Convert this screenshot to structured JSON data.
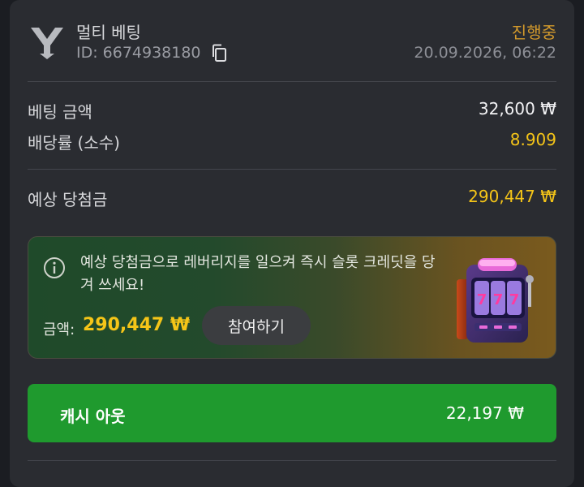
{
  "header": {
    "bet_type": "멀티 베팅",
    "id_label": "ID:",
    "id_value": "6674938180",
    "status": "진행중",
    "datetime": "20.09.2026, 06:22"
  },
  "details": {
    "stake_label": "베팅 금액",
    "stake_value": "32,600 ₩",
    "odds_label": "배당률 (소수)",
    "odds_value": "8.909"
  },
  "potential": {
    "label": "예상 당첨금",
    "value": "290,447 ₩"
  },
  "promo": {
    "text": "예상 당첨금으로 레버리지를 일으켜 즉시 슬롯 크레딧을 당겨 쓰세요!",
    "amount_label": "금액:",
    "amount_value": "290,447 ₩",
    "join_label": "참여하기",
    "slot_digits": "777"
  },
  "cashout": {
    "label": "캐시 아웃",
    "amount": "22,197 ₩"
  },
  "colors": {
    "status": "#d39a2c",
    "highlight": "#f5c518",
    "cashout_bg": "#1f9a2e",
    "card_bg": "#2a2c31"
  },
  "icons": [
    "bet-logo-icon",
    "copy-icon",
    "info-icon",
    "slot-machine-icon"
  ]
}
